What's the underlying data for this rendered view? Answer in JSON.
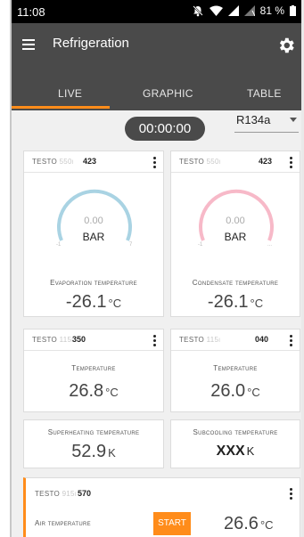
{
  "status": {
    "time": "11:08",
    "battery": "81 %"
  },
  "appbar": {
    "title": "Refrigeration"
  },
  "tabs": [
    {
      "label": "LIVE"
    },
    {
      "label": "GRAPHIC"
    },
    {
      "label": "TABLE"
    }
  ],
  "timer": "00:00:00",
  "refrigerant": "R134a",
  "cards": {
    "evap": {
      "brand": "TESTO",
      "model": "550i",
      "id": "423",
      "gauge_value": "0.00",
      "gauge_unit": "BAR",
      "label": "Evaporation temperature",
      "value": "-26.1",
      "unit": "°C"
    },
    "cond": {
      "brand": "TESTO",
      "model": "550i",
      "id": "423",
      "gauge_value": "0.00",
      "gauge_unit": "BAR",
      "label": "Condensate temperature",
      "value": "-26.1",
      "unit": "°C"
    },
    "temp1": {
      "brand": "TESTO",
      "model": "115i",
      "id": "350",
      "label": "Temperature",
      "value": "26.8",
      "unit": "°C"
    },
    "temp2": {
      "brand": "TESTO",
      "model": "115i",
      "id": "040",
      "label": "Temperature",
      "value": "26.0",
      "unit": "°C"
    },
    "superheat": {
      "label": "Superheating temperature",
      "value": "52.9",
      "unit": "K"
    },
    "subcool": {
      "label": "Subcooling temperature",
      "value": "XXX",
      "unit": "K"
    },
    "air": {
      "brand": "TESTO",
      "model": "915i",
      "id": "570",
      "label": "Air temperature",
      "button": "START",
      "value": "26.6",
      "unit": "°C"
    }
  },
  "colors": {
    "appbar": "#4a4a4a",
    "accent": "#ff8c1a",
    "gauge_low": "#a9d3e3",
    "gauge_high": "#f7b9c8"
  }
}
